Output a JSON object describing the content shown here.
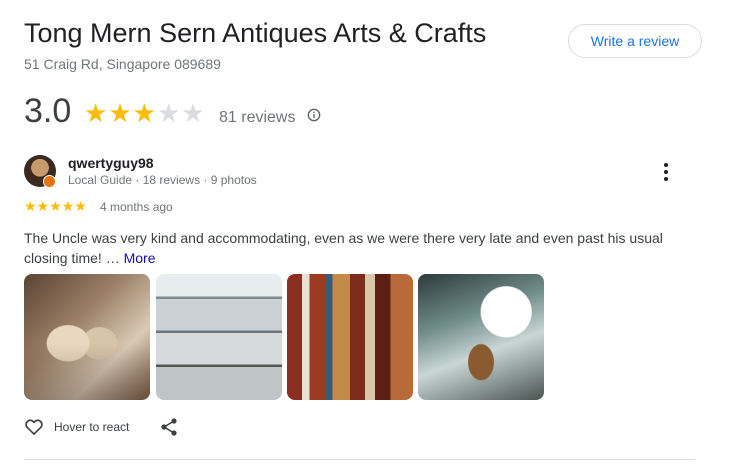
{
  "place": {
    "name": "Tong Mern Sern Antiques Arts & Crafts",
    "address": "51 Craig Rd, Singapore 089689",
    "write_review_label": "Write a review"
  },
  "summary": {
    "rating": "3.0",
    "stars_filled": 3,
    "stars_total": 5,
    "review_count_text": "81 reviews",
    "star_color": "#fbbc04"
  },
  "review": {
    "author": "qwertyguy98",
    "author_meta": "Local Guide · 18 reviews · 9 photos",
    "stars": "★★★★★",
    "time": "4 months ago",
    "text": "The Uncle was very kind and accommodating, even as we were there very late and even past his usual closing time! …",
    "more_label": "More",
    "react_label": "Hover to react"
  },
  "icons": [
    "info-icon",
    "more-vert-icon",
    "local-guide-badge-icon",
    "heart-icon",
    "share-icon"
  ]
}
